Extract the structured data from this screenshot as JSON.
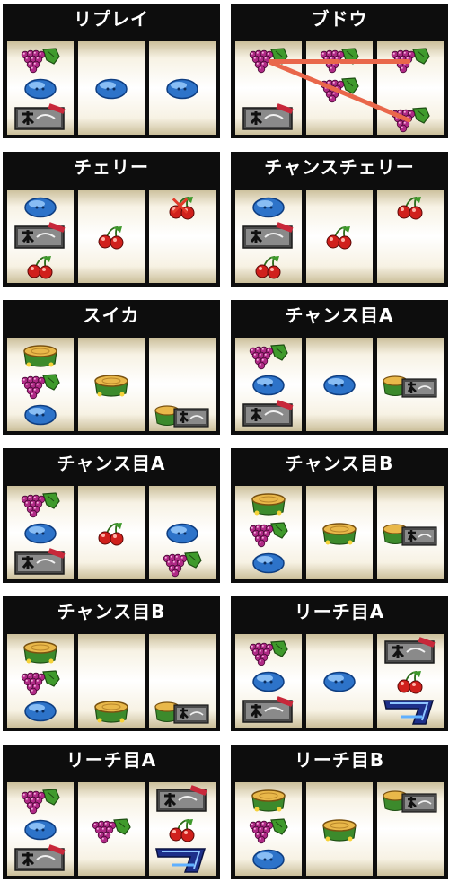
{
  "panels": [
    {
      "title": "リプレイ",
      "reels": [
        [
          "grape",
          "replay",
          "bar"
        ],
        [
          "",
          "replay",
          ""
        ],
        [
          "",
          "replay",
          ""
        ]
      ]
    },
    {
      "title": "ブドウ",
      "reels": [
        [
          "grape",
          "",
          "bar"
        ],
        [
          "grape",
          "grape",
          ""
        ],
        [
          "grape",
          "",
          "grape"
        ]
      ],
      "lines": true
    },
    {
      "title": "チェリー",
      "reels": [
        [
          "replay",
          "bar",
          "cherry"
        ],
        [
          "",
          "cherry",
          ""
        ],
        [
          "cherry-x",
          "",
          ""
        ]
      ]
    },
    {
      "title": "チャンスチェリー",
      "reels": [
        [
          "replay",
          "bar",
          "cherry"
        ],
        [
          "",
          "cherry",
          ""
        ],
        [
          "cherry",
          "",
          ""
        ]
      ]
    },
    {
      "title": "スイカ",
      "reels": [
        [
          "stump",
          "grape",
          "replay"
        ],
        [
          "",
          "stump",
          ""
        ],
        [
          "",
          "",
          "stumpbar"
        ]
      ]
    },
    {
      "title": "チャンス目A",
      "reels": [
        [
          "grape",
          "replay",
          "bar"
        ],
        [
          "",
          "replay",
          ""
        ],
        [
          "",
          "stumpbar",
          ""
        ]
      ]
    },
    {
      "title": "チャンス目A",
      "reels": [
        [
          "grape",
          "replay",
          "bar"
        ],
        [
          "",
          "cherry",
          ""
        ],
        [
          "",
          "replay",
          "grape"
        ]
      ]
    },
    {
      "title": "チャンス目B",
      "reels": [
        [
          "stump",
          "grape",
          "replay"
        ],
        [
          "",
          "stump",
          ""
        ],
        [
          "",
          "stumpbar",
          ""
        ]
      ]
    },
    {
      "title": "チャンス目B",
      "reels": [
        [
          "stump",
          "grape",
          "replay"
        ],
        [
          "",
          "",
          "stump"
        ],
        [
          "",
          "",
          "stumpbar"
        ]
      ]
    },
    {
      "title": "リーチ目A",
      "reels": [
        [
          "grape",
          "replay",
          "bar"
        ],
        [
          "",
          "replay",
          ""
        ],
        [
          "bar",
          "cherry",
          "seven"
        ]
      ]
    },
    {
      "title": "リーチ目A",
      "reels": [
        [
          "grape",
          "replay",
          "bar"
        ],
        [
          "",
          "grape",
          ""
        ],
        [
          "bar",
          "cherry",
          "seven"
        ]
      ]
    },
    {
      "title": "リーチ目B",
      "reels": [
        [
          "stump",
          "grape",
          "replay"
        ],
        [
          "",
          "stump",
          ""
        ],
        [
          "stumpbar",
          "",
          ""
        ]
      ]
    }
  ]
}
